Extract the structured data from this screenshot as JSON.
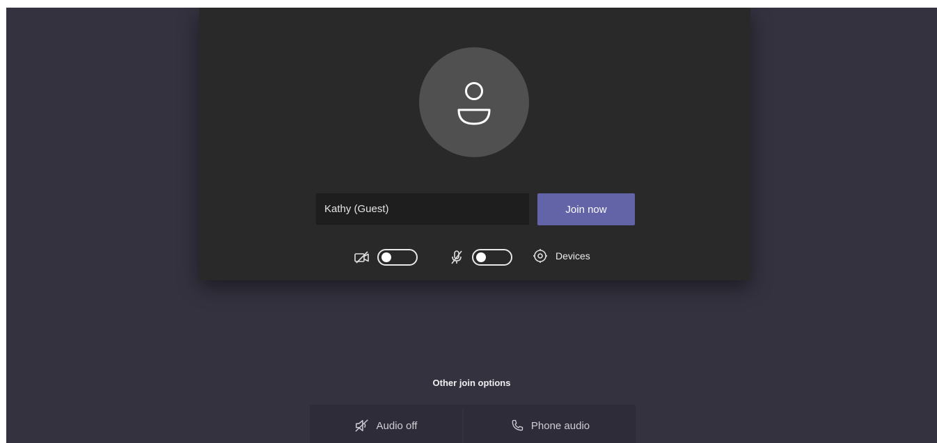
{
  "prejoin": {
    "name_value": "Kathy (Guest)",
    "join_label": "Join now",
    "video_toggle_on": false,
    "mic_toggle_on": false,
    "devices_label": "Devices",
    "other_options_title": "Other join options",
    "options": [
      {
        "label": "Audio off",
        "icon": "speaker-off-icon"
      },
      {
        "label": "Phone audio",
        "icon": "phone-icon"
      }
    ]
  },
  "colors": {
    "background": "#34323f",
    "card": "#292929",
    "accent": "#6264a7",
    "avatar": "#505050"
  }
}
